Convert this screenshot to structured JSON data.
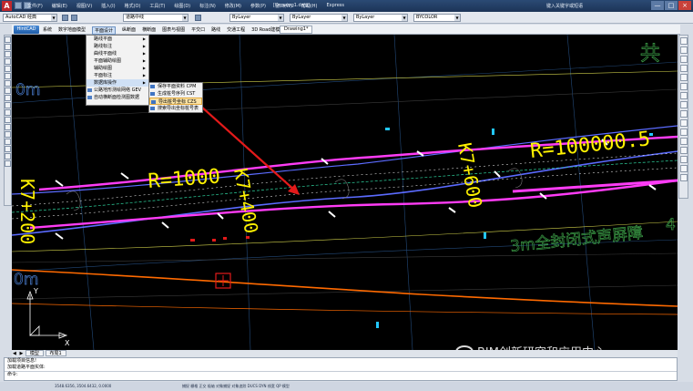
{
  "titlebar": {
    "menus": [
      "文件(F)",
      "编辑(E)",
      "视图(V)",
      "插入(I)",
      "格式(O)",
      "工具(T)",
      "绘图(D)",
      "标注(N)",
      "修改(M)",
      "参数(P)",
      "窗口(W)",
      "帮助(H)",
      "Express"
    ],
    "title": "[Drawing1.dwg]",
    "user": "键入关键字或短语",
    "controls": [
      "—",
      "□",
      "×"
    ]
  },
  "toolbar": {
    "workspace": "AutoCAD 经典",
    "layer": "道路中线",
    "color": "ByLayer",
    "linetype": "ByLayer",
    "lineweight": "ByLayer",
    "plotstyle": "BYCOLOR"
  },
  "ribbon": {
    "logo": "HintCAD",
    "tabs": [
      "系统",
      "数字地面模型",
      "平面设计",
      "纵断面",
      "横断面",
      "图表与视图",
      "平交口",
      "路线",
      "交通工程",
      "3D Road建模",
      "帮助"
    ],
    "active_tab": "平面设计",
    "drawing_tab": "Drawing1*"
  },
  "menu_level1": [
    {
      "label": "路线平面",
      "arrow": true
    },
    {
      "label": "路线标注",
      "arrow": true
    },
    {
      "label": "曲线平面线",
      "arrow": true
    },
    {
      "label": "平面辅助绘图",
      "arrow": true
    },
    {
      "label": "辅助绘图",
      "arrow": true
    },
    {
      "label": "平面标注",
      "arrow": true
    },
    {
      "label": "数据库操作",
      "arrow": true
    },
    {
      "label": "公路地形测绘网络 GEV",
      "arrow": false
    },
    {
      "label": "自动横断面检测图数据",
      "arrow": false
    }
  ],
  "menu_level2": [
    {
      "label": "保存平面资料 CPM",
      "highlighted": false
    },
    {
      "label": "生成桩号序列 CST",
      "highlighted": false
    },
    {
      "label": "导出桩号坐标 CZS",
      "highlighted": true
    },
    {
      "label": "搜索导出坐标桩号表",
      "highlighted": false
    }
  ],
  "drawing": {
    "labels": {
      "radius_1": "R=1000",
      "radius_2": "R=100000.5",
      "station_1": "K7+200",
      "station_2": "K7+400",
      "station_3": "K7+600",
      "barrier": "3m全封闭式声屏障",
      "barrier_suffix": "4",
      "top_right": "共",
      "top_left": "0m",
      "bottom_left": "0m"
    },
    "ucs": {
      "x": "X",
      "y": "Y"
    }
  },
  "layout_tabs": [
    "模型",
    "布局1"
  ],
  "command": {
    "line1": "加载项目信息!",
    "line2": "加载道路平面实体:",
    "prompt": "命令:"
  },
  "status": {
    "coords": "3548.6356, 3504.6432, 0.0000",
    "items": "捕捉  栅格  正交  极轴  对象捕捉  对象追踪  DUCS  DYN  线宽  QP  模型"
  },
  "watermark": "BIM创新研究和应用中心",
  "colors": {
    "canvas_bg": "#000000",
    "road_line_blue": "#5b6bff",
    "road_line_magenta": "#ff3cf6",
    "label_yellow": "#fff200",
    "orange_line": "#ff6a00",
    "cyan_marker": "#22c7ff",
    "red_arrow": "#e31a1a",
    "highlight": "#fbe3a6"
  }
}
